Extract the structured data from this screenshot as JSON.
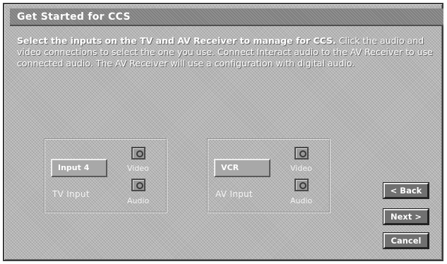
{
  "window": {
    "title": "Get Started for CCS"
  },
  "instructions": {
    "lead": "Select the inputs on the TV and AV Receiver to manage for CCS.",
    "body": "Click the audio and video connections to select the one you use. Connect Interact audio to the AV Receiver to use connected audio. The AV Receiver will use a configuration with digital audio."
  },
  "tv_group": {
    "input_value": "Input 4",
    "caption": "TV Input",
    "video_label": "Video",
    "audio_label": "Audio"
  },
  "av_group": {
    "input_value": "VCR",
    "caption": "AV Input",
    "video_label": "Video",
    "audio_label": "Audio"
  },
  "buttons": {
    "back": "< Back",
    "next": "Next >",
    "cancel": "Cancel"
  }
}
